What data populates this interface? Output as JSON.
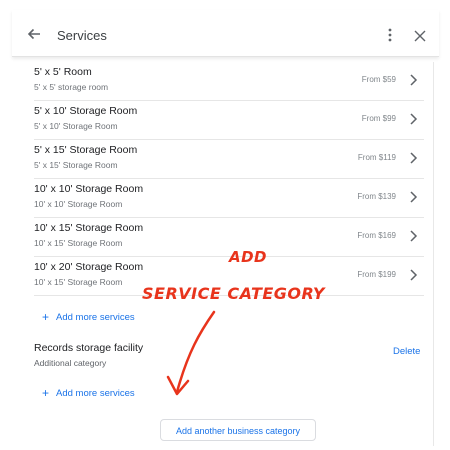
{
  "header": {
    "title": "Services",
    "back_icon": "arrow-back-icon",
    "more_icon": "more-vert-icon",
    "close_icon": "close-icon"
  },
  "services": [
    {
      "name": "5' x 5' Room",
      "desc": "5' x 5' storage room",
      "price": "From $59"
    },
    {
      "name": "5' x 10' Storage Room",
      "desc": "5' x 10' Storage Room",
      "price": "From $99"
    },
    {
      "name": "5' x 15' Storage Room",
      "desc": "5' x 15' Storage Room",
      "price": "From $119"
    },
    {
      "name": "10' x 10' Storage Room",
      "desc": "10' x 10' Storage Room",
      "price": "From $139"
    },
    {
      "name": "10' x 15' Storage Room",
      "desc": "10' x 15' Storage Room",
      "price": "From $169"
    },
    {
      "name": "10' x 20' Storage Room",
      "desc": "10' x 15' Storage Room",
      "price": "From $199"
    }
  ],
  "add_more_services": "Add more services",
  "category": {
    "name": "Records storage facility",
    "subtitle": "Additional category",
    "delete_label": "Delete"
  },
  "add_category_button": "Add another business category",
  "annotation": {
    "line1": "ADD",
    "line2": "SERVICE CATEGORY",
    "color": "#e8341c"
  },
  "colors": {
    "accent": "#1a73e8",
    "text": "#202124",
    "secondary_text": "#6f7378"
  }
}
